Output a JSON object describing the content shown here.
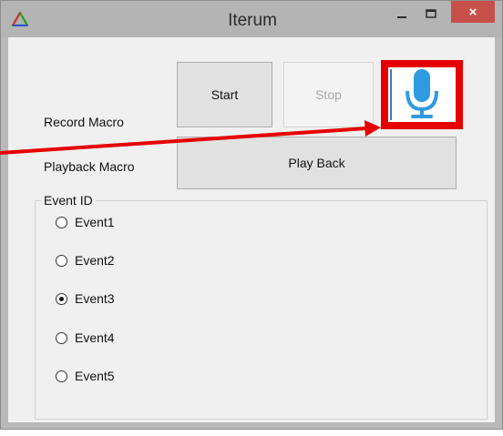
{
  "window": {
    "title": "Iterum",
    "close_glyph": "×",
    "logo_icon": "triangle-logo-icon",
    "close_color": "#c7504a"
  },
  "record": {
    "label": "Record Macro",
    "start_label": "Start",
    "stop_label": "Stop",
    "mic_icon": "microphone-icon",
    "mic_color": "#2f9be0"
  },
  "playback": {
    "label": "Playback Macro",
    "play_back_label": "Play Back"
  },
  "event_group": {
    "legend": "Event ID",
    "options": [
      {
        "label": "Event1",
        "checked": false
      },
      {
        "label": "Event2",
        "checked": false
      },
      {
        "label": "Event3",
        "checked": true
      },
      {
        "label": "Event4",
        "checked": false
      },
      {
        "label": "Event5",
        "checked": false
      }
    ]
  },
  "annotation": {
    "highlight_color": "#e60000"
  }
}
